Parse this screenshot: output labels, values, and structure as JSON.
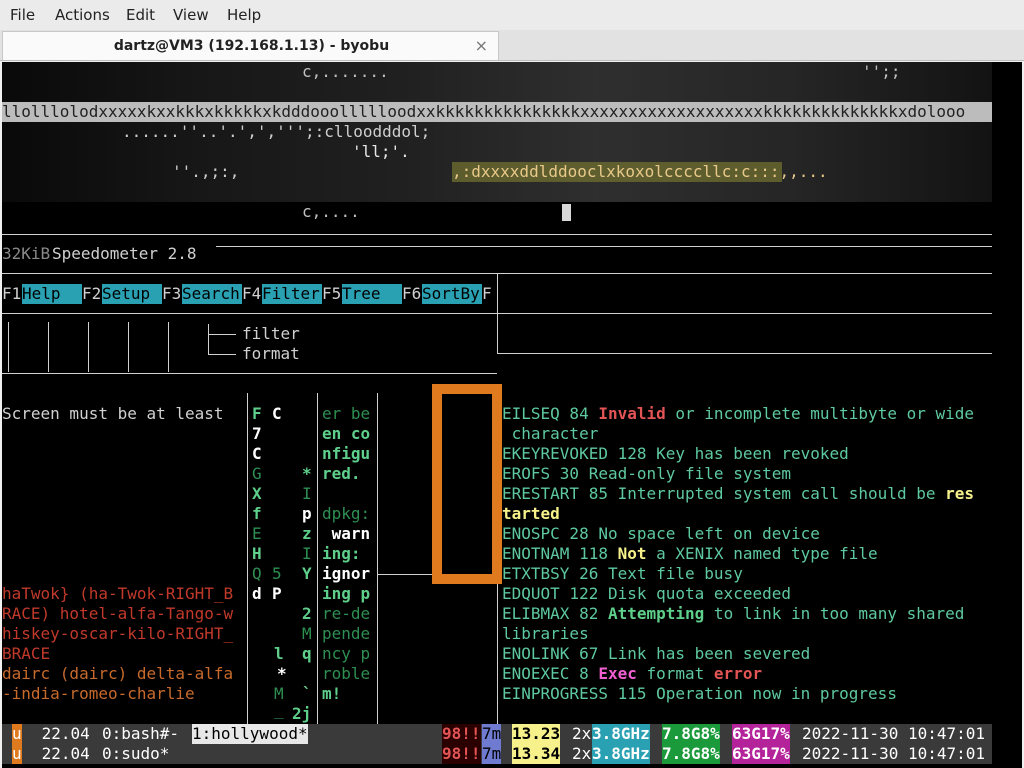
{
  "menu": {
    "file": "File",
    "actions": "Actions",
    "edit": "Edit",
    "view": "View",
    "help": "Help"
  },
  "tab": {
    "title": "dartz@VM3 (192.168.1.13) - byobu",
    "close": "×"
  },
  "art": {
    "r1": "c,.......",
    "r1b": "'';;",
    "r2": "llolllolodxxxxxkxxkkkxkkkkkxkdddooollllloodxxkkkkkkkkkkkkkkkxxxxxxxxxxxxxxxxxxxkkkkkkkkkkkkkkxdolooo",
    "r3": "......''..'.',',''';:clloodddol;",
    "r4": "'ll;'.",
    "r5a": "''.,;:,",
    "r5b": ",:dxxxxddlddooclxkoxolccccllc:c:::,,...",
    "r6": "c,...."
  },
  "speedo": {
    "size": "32KiB",
    "label": "Speedometer 2.8"
  },
  "fkeys": [
    {
      "key": "F1",
      "label": "Help  "
    },
    {
      "key": "F2",
      "label": "Setup "
    },
    {
      "key": "F3",
      "label": "Search"
    },
    {
      "key": "F4",
      "label": "Filter"
    },
    {
      "key": "F5",
      "label": "Tree  "
    },
    {
      "key": "F6",
      "label": "SortBy"
    },
    {
      "key": "F",
      "label": ""
    }
  ],
  "tree": {
    "filter": "filter",
    "format": "format"
  },
  "screen_msg": "Screen must be at least",
  "col_a": [
    "F",
    "7",
    "C",
    "G",
    "X",
    "f",
    "E",
    "H",
    "Q",
    "d"
  ],
  "col_b": [
    "C",
    "",
    "",
    "",
    "",
    "",
    "",
    "",
    "5",
    "P"
  ],
  "col_c": [
    "",
    "",
    "",
    "*",
    "I",
    "p",
    "z",
    "I",
    "Y",
    "",
    "2",
    "M",
    "q",
    "*",
    "`",
    "2j"
  ],
  "col_d": [
    "er be",
    "en co",
    "nfigu",
    "red.",
    "",
    "dpkg:",
    " warn",
    "ing:",
    "ignor",
    "ing p",
    "re-de",
    "pende",
    "ncy p",
    "roble",
    "m!"
  ],
  "ltr": [
    "l",
    "*",
    "M",
    "_"
  ],
  "lmsg": [
    "haTwok} (ha-Twok-RIGHT_B",
    "RACE) hotel-alfa-Tango-w",
    "hiskey-oscar-kilo-RIGHT_",
    "BRACE",
    "dairc (dairc) delta-alfa",
    "-india-romeo-charlie"
  ],
  "errors": [
    {
      "pre": "EILSEQ 84 ",
      "em": "Invalid",
      "post": " or incomplete multibyte or wide"
    },
    {
      "pre": " character",
      "em": "",
      "post": ""
    },
    {
      "pre": "EKEYREVOKED 128 Key has been revoked",
      "em": "",
      "post": ""
    },
    {
      "pre": "EROFS 30 Read-only file system",
      "em": "",
      "post": ""
    },
    {
      "pre": "ERESTART 85 Interrupted system call should be ",
      "em": "res",
      "post": ""
    },
    {
      "pre": "",
      "em": "tarted",
      "post": ""
    },
    {
      "pre": "ENOSPC 28 No space left on device",
      "em": "",
      "post": ""
    },
    {
      "pre": "ENOTNAM 118 ",
      "em": "Not",
      "post": " a XENIX named type file"
    },
    {
      "pre": "ETXTBSY 26 Text file busy",
      "em": "",
      "post": ""
    },
    {
      "pre": "EDQUOT 122 Disk quota exceeded",
      "em": "",
      "post": ""
    },
    {
      "pre": "ELIBMAX 82 ",
      "em": "Attempting",
      "post": " to link in too many shared"
    },
    {
      "pre": "libraries",
      "em": "",
      "post": ""
    },
    {
      "pre": "ENOLINK 67 Link has been severed",
      "em": "",
      "post": ""
    },
    {
      "pre": "ENOEXEC 8 ",
      "em": "Exec",
      "post": " format ",
      "em2": "error"
    },
    {
      "pre": "EINPROGRESS 115 Operation now in progress",
      "em": "",
      "post": ""
    }
  ],
  "status": [
    {
      "logo": "u",
      "ver": " 22.04 ",
      "w0": "0:bash#-",
      "w1": "1:hollywood*",
      "bang": "98!!",
      "up": "7m",
      "load": "13.23",
      "cpu": "2x",
      "ghz": "3.8GHz",
      "mem": "7.8G8%",
      "disk": "63G17%",
      "date": "2022-11-30 10:47:01"
    },
    {
      "logo": "u",
      "ver": " 22.04 ",
      "w0": "0:sudo*",
      "w1": "",
      "bang": "98!!",
      "up": "7m",
      "load": "13.34",
      "cpu": "2x",
      "ghz": "3.8GHz",
      "mem": "7.8G8%",
      "disk": "63G17%",
      "date": "2022-11-30 10:47:01"
    }
  ],
  "colors": {
    "cyan": "#2aa1b3",
    "green": "#5ed08b",
    "red": "#e35454",
    "orange": "#e07a1f",
    "yellow": "#f6f18a",
    "magenta": "#b5239b",
    "pink": "#f05fd0"
  }
}
